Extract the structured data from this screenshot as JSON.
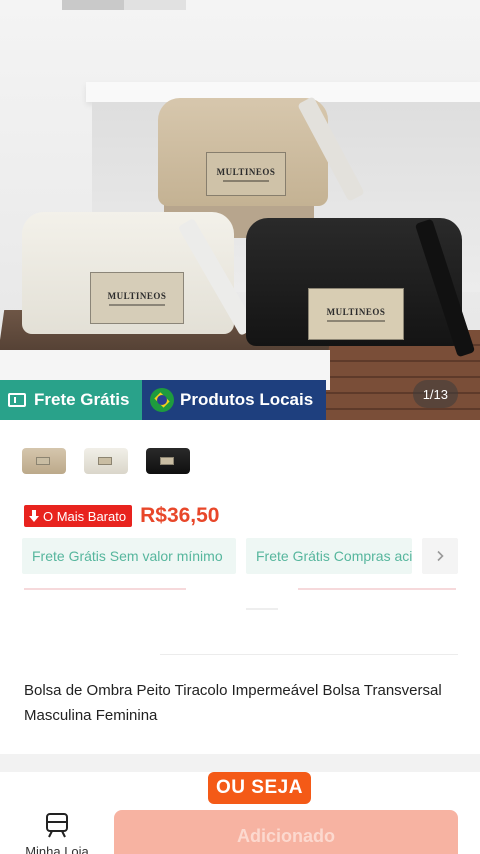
{
  "hero": {
    "brand_patch": "MULTINEOS",
    "counter": "1/13",
    "badges": {
      "frete": "Frete Grátis",
      "local": "Produtos Locais"
    }
  },
  "product": {
    "variants": [
      {
        "icon": "tan-bag-thumbnail"
      },
      {
        "icon": "white-bag-thumbnail"
      },
      {
        "icon": "black-bag-thumbnail"
      }
    ],
    "cheapest_label": "O Mais Barato",
    "price": "R$36,50",
    "shipping_chips": [
      "Frete Grátis Sem valor mínimo",
      "Frete Grátis Compras acima"
    ],
    "title": "Bolsa de Ombra Peito Tiracolo Impermeável Bolsa Transversal Masculina  Feminina"
  },
  "bottom_bar": {
    "store_label": "Minha Loja",
    "add_button": "Adicionado"
  },
  "overlay_caption": "OU SEJA",
  "colors": {
    "frete_badge": "#29a28a",
    "local_badge": "#1e3f7e",
    "price": "#e8472a",
    "cheapest_badge": "#e8231e",
    "add_button": "#f7b3a2",
    "caption": "#f45a17"
  }
}
